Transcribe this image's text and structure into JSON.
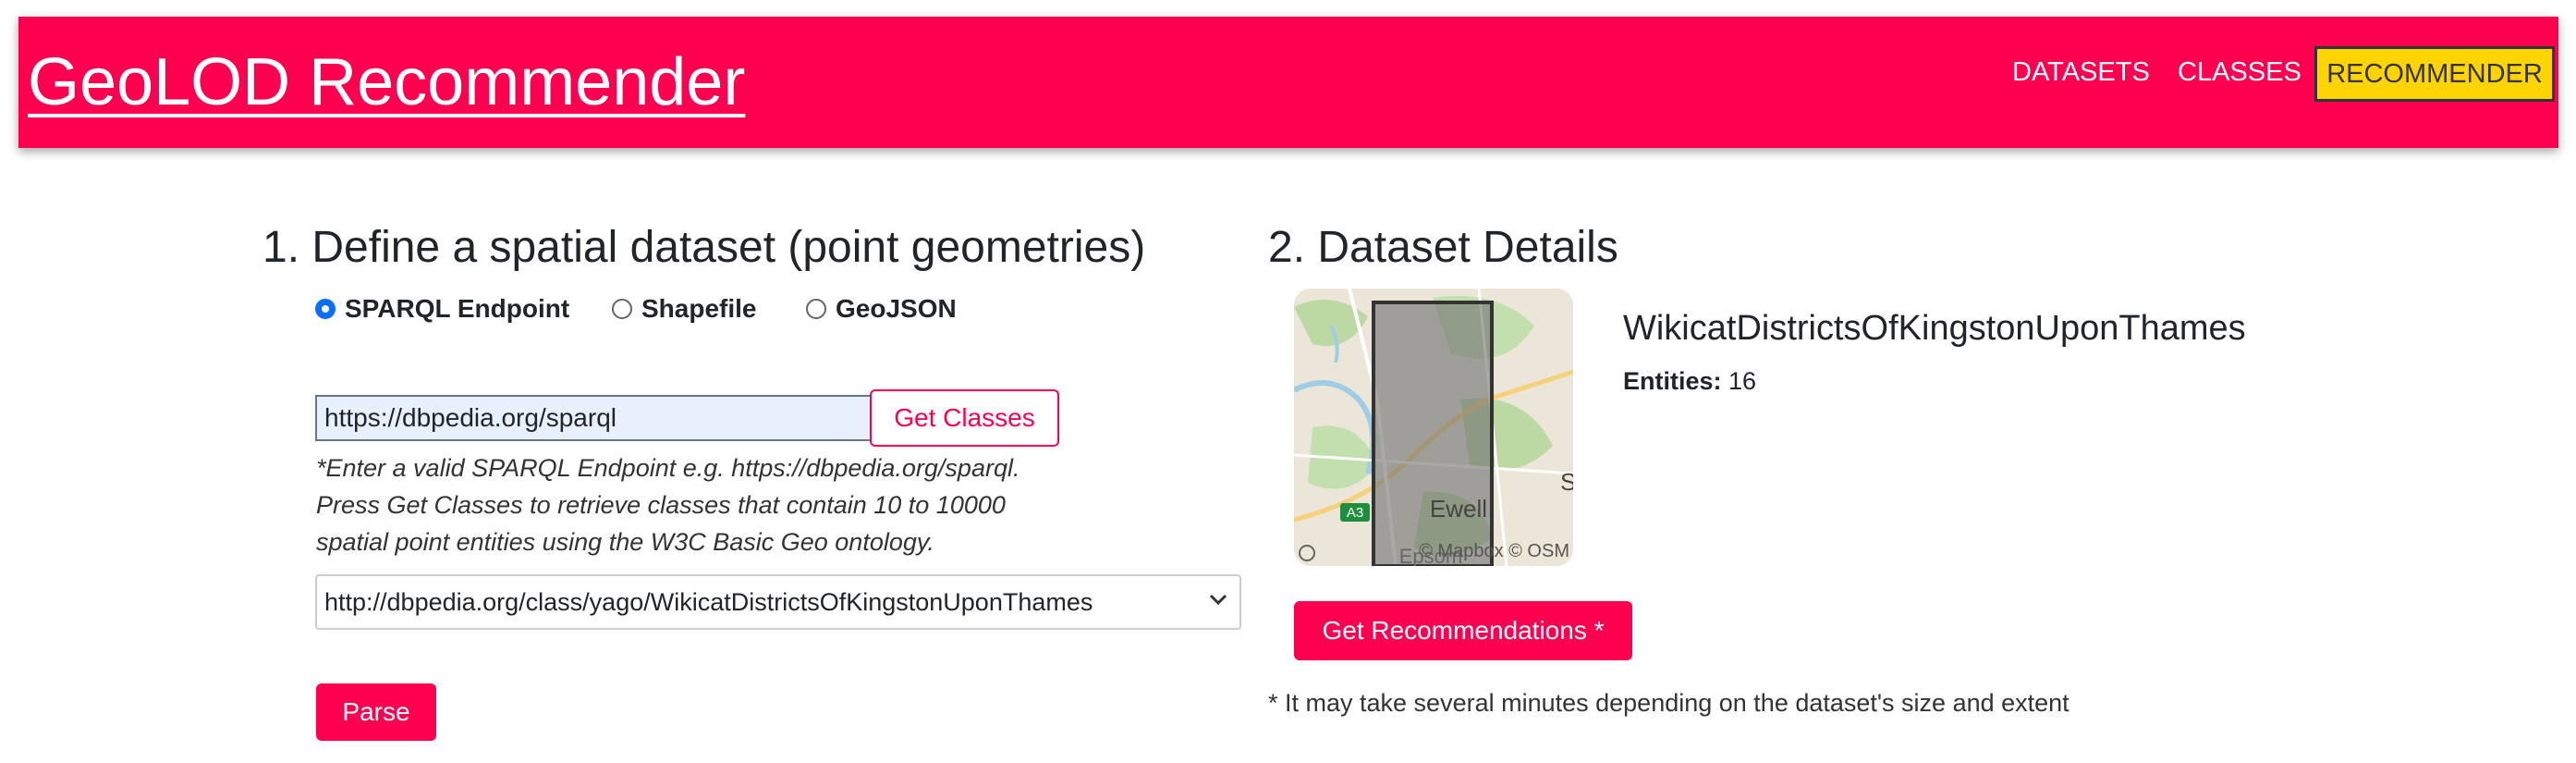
{
  "header": {
    "brand": "GeoLOD Recommender",
    "nav": [
      "DATASETS",
      "CLASSES",
      "RECOMMENDER"
    ],
    "active_nav": "RECOMMENDER",
    "brand_color": "#ff0050",
    "active_color": "#ffd400"
  },
  "step1": {
    "title": "1. Define a spatial dataset (point geometries)",
    "source_options": [
      {
        "label": "SPARQL Endpoint",
        "checked": true
      },
      {
        "label": "Shapefile",
        "checked": false
      },
      {
        "label": "GeoJSON",
        "checked": false
      }
    ],
    "endpoint_value": "https://dbpedia.org/sparql",
    "get_classes_label": "Get Classes",
    "hint_lines": [
      "*Enter a valid SPARQL Endpoint e.g. https://dbpedia.org/sparql.",
      "Press Get Classes to retrieve classes that contain 10 to 10000",
      "spatial point entities using the W3C Basic Geo ontology."
    ],
    "selected_class": "http://dbpedia.org/class/yago/WikicatDistrictsOfKingstonUponThames",
    "parse_label": "Parse"
  },
  "step2": {
    "title": "2. Dataset Details",
    "dataset_name": "WikicatDistrictsOfKingstonUponThames",
    "entities_label": "Entities:",
    "entities_value": "16",
    "map_labels": {
      "town": "Ewell",
      "road": "A3",
      "edge": "S",
      "cut": "Epsom",
      "attribution": "© Mapbox © OSM"
    },
    "recommend_label": "Get Recommendations *",
    "note": "* It may take several minutes depending on the dataset's size and extent"
  }
}
